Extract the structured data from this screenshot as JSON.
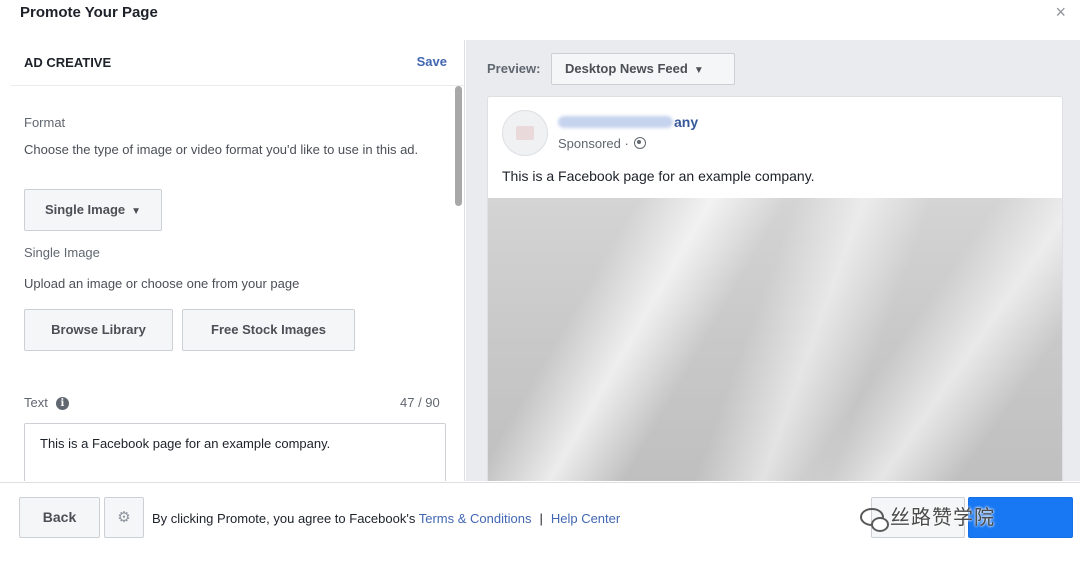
{
  "header": {
    "title": "Promote Your Page",
    "close_label": "×"
  },
  "ad_creative": {
    "title": "AD CREATIVE",
    "save_label": "Save",
    "format": {
      "label": "Format",
      "description": "Choose the type of image or video format you'd like to use in this ad.",
      "selected": "Single Image"
    },
    "single_image": {
      "label": "Single Image",
      "description": "Upload an image or choose one from your page",
      "browse_label": "Browse Library",
      "stock_label": "Free Stock Images"
    },
    "text": {
      "label": "Text",
      "counter": "47 / 90",
      "value": "This is a Facebook page for an example company."
    }
  },
  "preview": {
    "label": "Preview:",
    "placement": "Desktop News Feed",
    "post": {
      "page_name_visible": "any",
      "sponsored": "Sponsored ·",
      "text": "This is a Facebook page for an example company."
    }
  },
  "footer": {
    "back_label": "Back",
    "gear_icon": "⚙",
    "agree_prefix": "By clicking Promote, you agree to Facebook's",
    "terms_link": "Terms & Conditions",
    "separator": "|",
    "help_link": "Help Center",
    "watermark_text": "丝路赞学院"
  },
  "colors": {
    "link": "#4267b2",
    "primary_button": "#1877f2",
    "panel_background": "#e9ebee"
  }
}
